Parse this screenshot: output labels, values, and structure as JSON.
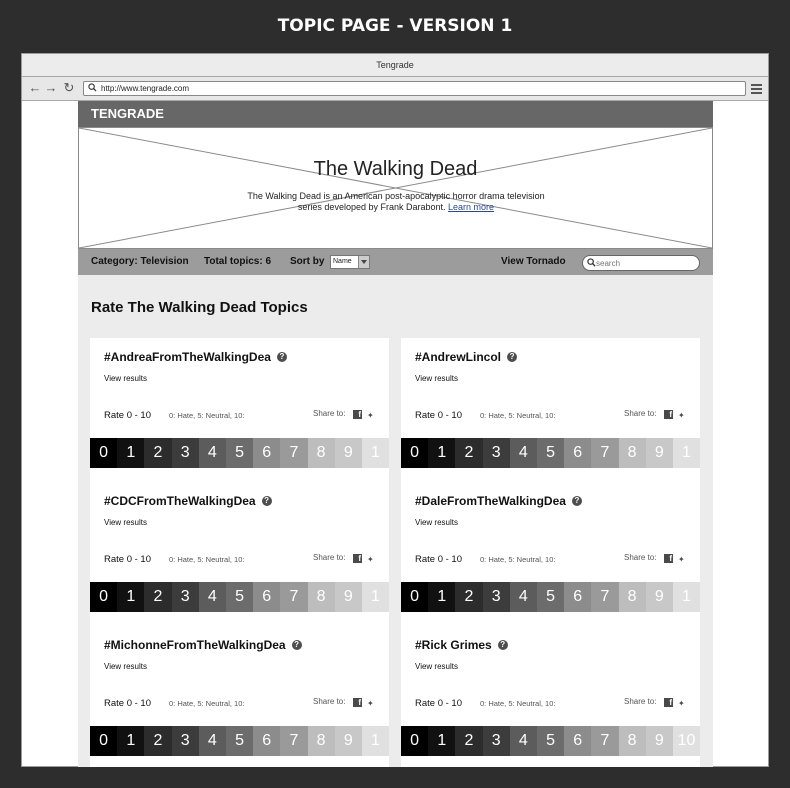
{
  "doc_title": "TOPIC PAGE - VERSION 1",
  "browser": {
    "window_title": "Tengrade",
    "url": "http://www.tengrade.com"
  },
  "site": {
    "brand": "TENGRADE",
    "hero": {
      "title": "The Walking Dead",
      "description": "The Walking Dead is an American post-apocalyptic horror drama television series developed by Frank Darabont.",
      "learn_more": "Learn more"
    },
    "filters": {
      "category": "Category: Television",
      "total_topics": "Total topics: 6",
      "sort_label": "Sort by",
      "sort_value": "Name",
      "view_tornado": "View Tornado",
      "search_placeholder": "search"
    },
    "section_title": "Rate The Walking Dead Topics"
  },
  "card_labels": {
    "view_results": "View results",
    "rate_label": "Rate 0 - 10",
    "rate_scale": "0: Hate, 5: Neutral, 10:",
    "share_to": "Share to:"
  },
  "cards": [
    {
      "title": "#AndreaFromTheWalkingDea",
      "ratings": [
        "0",
        "1",
        "2",
        "3",
        "4",
        "5",
        "6",
        "7",
        "8",
        "9",
        "1"
      ]
    },
    {
      "title": "#AndrewLincol",
      "ratings": [
        "0",
        "1",
        "2",
        "3",
        "4",
        "5",
        "6",
        "7",
        "8",
        "9",
        "1"
      ]
    },
    {
      "title": "#CDCFromTheWalkingDea",
      "ratings": [
        "0",
        "1",
        "2",
        "3",
        "4",
        "5",
        "6",
        "7",
        "8",
        "9",
        "1"
      ]
    },
    {
      "title": "#DaleFromTheWalkingDea",
      "ratings": [
        "0",
        "1",
        "2",
        "3",
        "4",
        "5",
        "6",
        "7",
        "8",
        "9",
        "1"
      ]
    },
    {
      "title": "#MichonneFromTheWalkingDea",
      "ratings": [
        "0",
        "1",
        "2",
        "3",
        "4",
        "5",
        "6",
        "7",
        "8",
        "9",
        "1"
      ]
    },
    {
      "title": "#Rick Grimes",
      "ratings": [
        "0",
        "1",
        "2",
        "3",
        "4",
        "5",
        "6",
        "7",
        "8",
        "9",
        "10"
      ]
    }
  ],
  "rating_colors": [
    "#000000",
    "#111111",
    "#2c2c2c",
    "#3c3c3c",
    "#5c5c5c",
    "#6c6c6c",
    "#8c8c8c",
    "#9a9a9a",
    "#bdbdbd",
    "#c8c8c8",
    "#e0e0e0"
  ],
  "icons": {
    "back": "arrow-left-icon",
    "forward": "arrow-right-icon",
    "reload": "reload-icon",
    "menu": "hamburger-menu-icon",
    "help": "question-icon",
    "facebook": "facebook-icon",
    "twitter": "twitter-icon",
    "search": "search-icon"
  }
}
